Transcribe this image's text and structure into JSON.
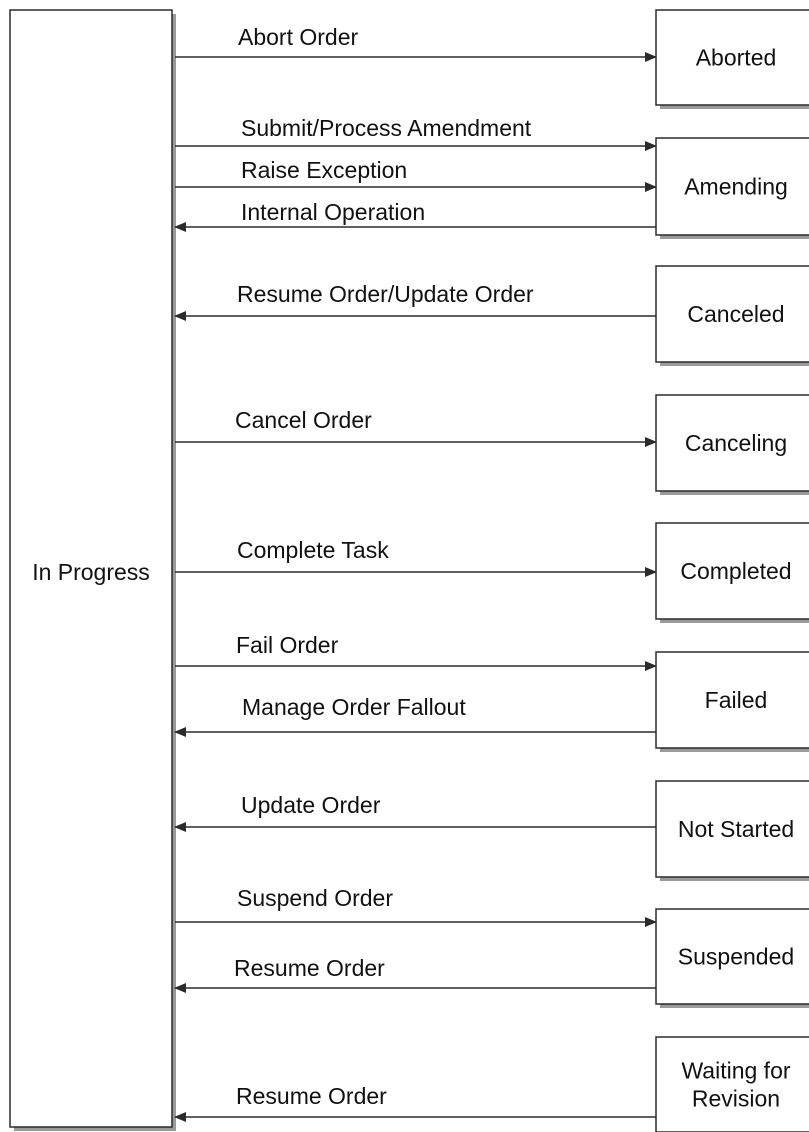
{
  "source_state": "In Progress",
  "states": [
    {
      "name": "Aborted"
    },
    {
      "name": "Amending"
    },
    {
      "name": "Canceled"
    },
    {
      "name": "Canceling"
    },
    {
      "name": "Completed"
    },
    {
      "name": "Failed"
    },
    {
      "name": "Not Started"
    },
    {
      "name": "Suspended"
    },
    {
      "name": "Waiting for Revision",
      "lines": [
        "Waiting for",
        "Revision"
      ]
    }
  ],
  "transitions": [
    {
      "label": "Abort Order",
      "direction": "to-state",
      "state": "Aborted"
    },
    {
      "label": "Submit/Process Amendment",
      "direction": "to-state",
      "state": "Amending"
    },
    {
      "label": "Raise Exception",
      "direction": "to-state",
      "state": "Amending"
    },
    {
      "label": "Internal Operation",
      "direction": "to-in-progress",
      "state": "Amending"
    },
    {
      "label": "Resume Order/Update Order",
      "direction": "to-in-progress",
      "state": "Canceled"
    },
    {
      "label": "Cancel Order",
      "direction": "to-state",
      "state": "Canceling"
    },
    {
      "label": "Complete Task",
      "direction": "to-state",
      "state": "Completed"
    },
    {
      "label": "Fail Order",
      "direction": "to-state",
      "state": "Failed"
    },
    {
      "label": "Manage Order Fallout",
      "direction": "to-in-progress",
      "state": "Failed"
    },
    {
      "label": "Update Order",
      "direction": "to-in-progress",
      "state": "Not Started"
    },
    {
      "label": "Suspend Order",
      "direction": "to-state",
      "state": "Suspended"
    },
    {
      "label": "Resume Order",
      "direction": "to-in-progress",
      "state": "Suspended"
    },
    {
      "label": "Resume Order",
      "direction": "to-in-progress",
      "state": "Waiting for Revision"
    }
  ],
  "colors": {
    "line": "#2b2b2b",
    "box_fill": "#ffffff",
    "box_shadow": "#9a9a9a",
    "text": "#111111"
  }
}
